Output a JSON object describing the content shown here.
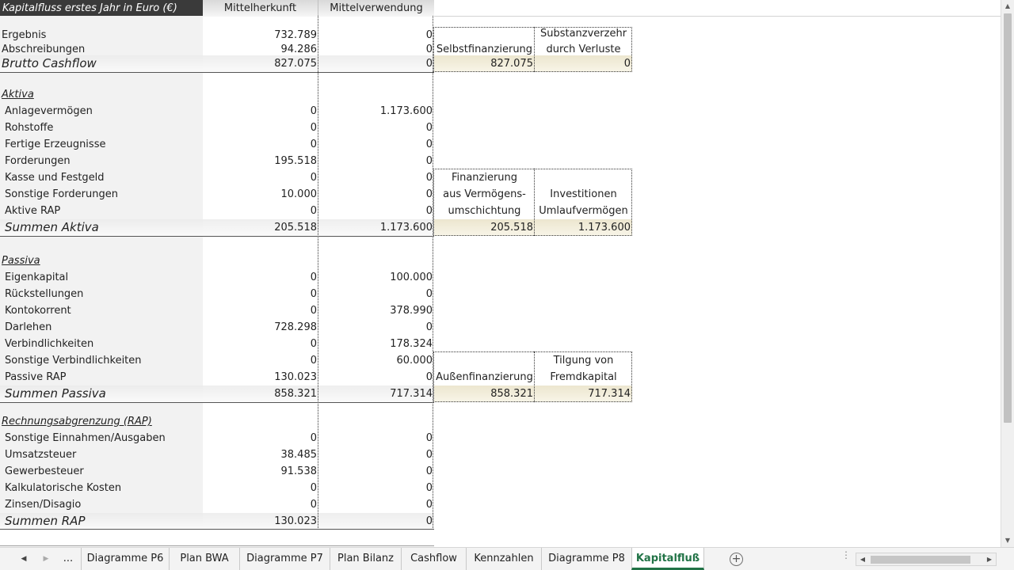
{
  "header": {
    "title": "Kapitalfluss erstes Jahr in Euro (€)",
    "col_b": "Mittelherkunft",
    "col_c": "Mittelverwendung"
  },
  "cashflow": {
    "rows": [
      {
        "label": "Ergebnis",
        "b": "732.789",
        "c": "0"
      },
      {
        "label": "Abschreibungen",
        "b": "94.286",
        "c": "0"
      }
    ],
    "sum": {
      "label": "Brutto Cashflow",
      "b": "827.075",
      "c": "0"
    },
    "box": {
      "left_label": "Selbstfinanzierung",
      "right_line1": "Substanzverzehr",
      "right_line2": "durch Verluste",
      "left_value": "827.075",
      "right_value": "0"
    }
  },
  "aktiva": {
    "title": "Aktiva",
    "rows": [
      {
        "label": "Anlagevermögen",
        "b": "0",
        "c": "1.173.600"
      },
      {
        "label": "Rohstoffe",
        "b": "0",
        "c": "0"
      },
      {
        "label": "Fertige Erzeugnisse",
        "b": "0",
        "c": "0"
      },
      {
        "label": "Forderungen",
        "b": "195.518",
        "c": "0"
      },
      {
        "label": "Kasse und Festgeld",
        "b": "0",
        "c": "0"
      },
      {
        "label": "Sonstige Forderungen",
        "b": "10.000",
        "c": "0"
      },
      {
        "label": "Aktive RAP",
        "b": "0",
        "c": "0"
      }
    ],
    "sum": {
      "label": "Summen Aktiva",
      "b": "205.518",
      "c": "1.173.600"
    },
    "box": {
      "left_line1": "Finanzierung",
      "left_line2": "aus Vermögens-",
      "left_line3": "umschichtung",
      "right_line1": "Investitionen",
      "right_line2": "Umlaufvermögen",
      "left_value": "205.518",
      "right_value": "1.173.600"
    }
  },
  "passiva": {
    "title": "Passiva",
    "rows": [
      {
        "label": "Eigenkapital",
        "b": "0",
        "c": "100.000"
      },
      {
        "label": "Rückstellungen",
        "b": "0",
        "c": "0"
      },
      {
        "label": "Kontokorrent",
        "b": "0",
        "c": "378.990"
      },
      {
        "label": "Darlehen",
        "b": "728.298",
        "c": "0"
      },
      {
        "label": "Verbindlichkeiten",
        "b": "0",
        "c": "178.324"
      },
      {
        "label": "Sonstige Verbindlichkeiten",
        "b": "0",
        "c": "60.000"
      },
      {
        "label": "Passive RAP",
        "b": "130.023",
        "c": "0"
      }
    ],
    "sum": {
      "label": "Summen Passiva",
      "b": "858.321",
      "c": "717.314"
    },
    "box": {
      "left_label": "Außenfinanzierung",
      "right_line1": "Tilgung von",
      "right_line2": "Fremdkapital",
      "left_value": "858.321",
      "right_value": "717.314"
    }
  },
  "rap": {
    "title": "Rechnungsabgrenzung (RAP)",
    "rows": [
      {
        "label": "Sonstige Einnahmen/Ausgaben",
        "b": "0",
        "c": "0"
      },
      {
        "label": "Umsatzsteuer",
        "b": "38.485",
        "c": "0"
      },
      {
        "label": "Gewerbesteuer",
        "b": "91.538",
        "c": "0"
      },
      {
        "label": "Kalkulatorische Kosten",
        "b": "0",
        "c": "0"
      },
      {
        "label": "Zinsen/Disagio",
        "b": "0",
        "c": "0"
      }
    ],
    "sum": {
      "label": "Summen RAP",
      "b": "130.023",
      "c": "0"
    }
  },
  "tabs": {
    "more": "...",
    "items": [
      "Diagramme P6",
      "Plan BWA",
      "Diagramme P7",
      "Plan Bilanz",
      "Cashflow",
      "Kennzahlen",
      "Diagramme P8",
      "Kapitalfluß"
    ],
    "active": "Kapitalfluß",
    "add": "+"
  },
  "icons": {
    "prev_sheet": "triangle-left-icon",
    "next_sheet": "triangle-right-icon",
    "add_sheet": "plus-circle-icon",
    "scroll_up": "arrow-up-icon",
    "scroll_down": "arrow-down-icon"
  },
  "colors": {
    "accent": "#217346",
    "header_dark": "#3a3a3a",
    "label_column": "#f2f2f2",
    "sum_box": "#ece6cf"
  }
}
